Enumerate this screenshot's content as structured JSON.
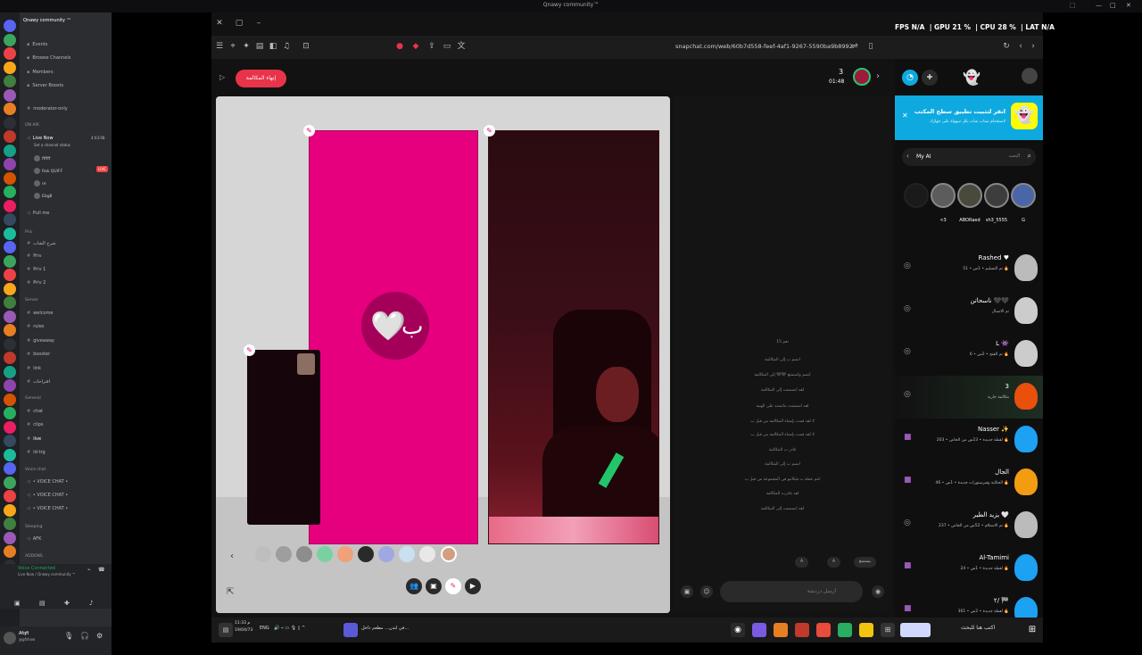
{
  "window": {
    "title": "Qnawy community™",
    "minimize": "—",
    "maximize": "□",
    "close": "✕"
  },
  "discord": {
    "server_name": "Qnawy community ™",
    "channels": [
      {
        "kind": "item",
        "label": "Events",
        "icon": "calendar-icon"
      },
      {
        "kind": "item",
        "label": "Browse Channels",
        "icon": "list-icon"
      },
      {
        "kind": "item",
        "label": "Members",
        "icon": "members-icon"
      },
      {
        "kind": "item",
        "label": "Server Boosts",
        "icon": "boost-icon"
      },
      {
        "kind": "text",
        "label": "moderator-only"
      },
      {
        "kind": "category",
        "label": "ON AIR"
      },
      {
        "kind": "voice",
        "label": "Live Now",
        "active": true
      },
      {
        "kind": "voice",
        "label": "Pull me"
      },
      {
        "kind": "category",
        "label": "Priv"
      },
      {
        "kind": "text",
        "label": "شرح الشاب"
      },
      {
        "kind": "text",
        "label": "Priv"
      },
      {
        "kind": "text",
        "label": "Priv 1"
      },
      {
        "kind": "text",
        "label": "Priv 2"
      },
      {
        "kind": "category",
        "label": "Server"
      },
      {
        "kind": "text",
        "label": "welcome"
      },
      {
        "kind": "text",
        "label": "rules"
      },
      {
        "kind": "text",
        "label": "giveaway"
      },
      {
        "kind": "text",
        "label": "booster"
      },
      {
        "kind": "text",
        "label": "link"
      },
      {
        "kind": "text",
        "label": "اقتراحات"
      },
      {
        "kind": "category",
        "label": "General"
      },
      {
        "kind": "text",
        "label": "chat"
      },
      {
        "kind": "text",
        "label": "clips"
      },
      {
        "kind": "text",
        "label": "live",
        "active": true
      },
      {
        "kind": "text",
        "label": "ld-trg"
      },
      {
        "kind": "category",
        "label": "Voice chat"
      },
      {
        "kind": "voice",
        "label": "• VOICE CHAT •"
      },
      {
        "kind": "voice",
        "label": "• VOICE CHAT •"
      },
      {
        "kind": "voice",
        "label": "• VOICE CHAT •"
      },
      {
        "kind": "category",
        "label": "Sleeping"
      },
      {
        "kind": "voice",
        "label": "AFK"
      },
      {
        "kind": "category",
        "label": "ADDONS"
      }
    ],
    "live_time": "4:03:08",
    "live_status": "Set a channel status",
    "live_members": [
      "ffffff",
      "Rak QUIFF",
      "re",
      "Ebg8"
    ],
    "live_badge": "LIVE",
    "voice_connected": "Voice Connected",
    "voice_sub": "Live Now / Qnawy community ™",
    "username": "Afqfi",
    "user_status": "@gfshow"
  },
  "browser": {
    "url": "snapchat.com/web/60b7d558-feef-4af1-9267-5590ba9b8992"
  },
  "call": {
    "end_call_label": "إنهاء المكالمة",
    "participants_count": "3",
    "timer": "01:48",
    "pink_tile_letter": "ب",
    "pink_tile_heart": "🤍"
  },
  "chat": {
    "system_messages": [
      "15 نعم",
      "انضم ب إلى المكالمة",
      "انضم واستمتع 🖤🖤 إلى المكالمة",
      "لقد انضممت إلى المكالمة",
      "لقد انضممت مانتمدد على الهيبة",
      "لا لقد قمت بإنشاء المكالمة من قبل ب",
      "لا لقد قمت بإنشاء المكالمة من قبل ب",
      "غادر ب المكالمة",
      "انضم ب إلى المكالمة",
      "انتم عملة ب فيكانبو في المجموعة من قبل ب",
      "لقد غادرت المكالمة",
      "لقد انضممت إلى المكالمة"
    ],
    "reply_chips": [
      "A",
      "A",
      "يستمتع"
    ],
    "input_placeholder": "أرسل دردشة"
  },
  "right_panel": {
    "banner_title": "انقر لتثبيت تطبيق سطح المكتب",
    "banner_sub": "لاستخدام سناب شات بكل سهولة على جهازك",
    "my_ai": "My AI",
    "search_placeholder": "البحث",
    "stories": [
      {
        "label": "<3",
        "color": "#5c5c5c"
      },
      {
        "label": "ABORaed",
        "color": "#4a4a3c"
      },
      {
        "label": "sh3_5555",
        "color": "#3d3d3d"
      },
      {
        "label": "G",
        "color": "#4b66a8"
      }
    ],
    "conversations": [
      {
        "name": "Rashed ♥",
        "sub": "تم التسليم • 1س • 51 🔥",
        "avatar": "#bbbbbb",
        "icon": "camera-icon"
      },
      {
        "name": "ناسحاتن 🖤🖤",
        "sub": "تم الاتصال",
        "avatar": "#cccccc",
        "icon": "camera-icon"
      },
      {
        "name": "L 👾",
        "sub": "تم الفتح • 2س • 6 🔥",
        "avatar": "#cccccc",
        "icon": "camera-icon"
      },
      {
        "name": "3",
        "sub": "مكالمة جارية",
        "avatar": "#e8500c",
        "icon": "camera-icon"
      },
      {
        "name": "Nasser ✨",
        "sub": "لقطة جديدة • 23س من الخاص • 203 🔥",
        "avatar": "#1da1f2",
        "icon": "snap-icon"
      },
      {
        "name": "الجال",
        "sub": "الحكاية وفيرستورات جديدة • 1س • 46 🔥",
        "avatar": "#f39c12",
        "icon": "snap-icon"
      },
      {
        "name": "يزيد الطير 🤍",
        "sub": "تم الاستلام • 52س من الخاص • 237 🔥",
        "avatar": "#bbbbbb",
        "icon": "camera-icon"
      },
      {
        "name": "Al-Tamimi",
        "sub": "لقطة جديدة • 1س • 24 🔥",
        "avatar": "#1da1f2",
        "icon": "snap-icon"
      },
      {
        "name": "٢/ 🏁",
        "sub": "لقطة جديدة • 2س • 301 🔥",
        "avatar": "#1da1f2",
        "icon": "snap-icon"
      }
    ]
  },
  "stats": {
    "fps": "FPS N/A",
    "gpu": "GPU 21 %",
    "cpu": "CPU 28 %",
    "lat": "LAT N/A"
  },
  "taskbar": {
    "search_placeholder": "اكتب هنا للبحث",
    "notification": "في لندن... مطعم داخل...",
    "lang": "ENG",
    "time": "11:33 م",
    "date": "19/04/73"
  },
  "colors": {
    "snap_yellow": "#fffc00",
    "call_red": "#e8344a",
    "pink_tile": "#e6007e",
    "banner_blue": "#0eaadf",
    "discord_bg": "#2b2d31"
  }
}
